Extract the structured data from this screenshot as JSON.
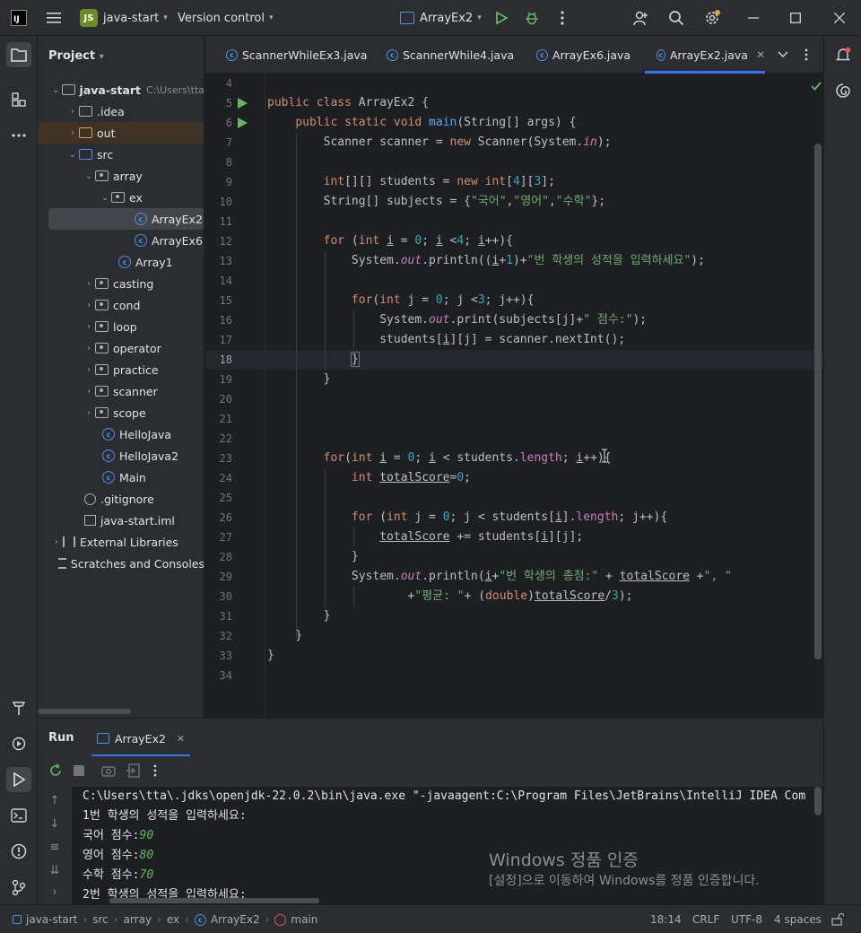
{
  "titlebar": {
    "project_badge": "JS",
    "project_name": "java-start",
    "vcs_label": "Version control",
    "run_config": "ArrayEx2"
  },
  "project_panel": {
    "title": "Project",
    "root_name": "java-start",
    "root_path": "C:\\Users\\tta",
    "items": [
      {
        "label": "java-start"
      },
      {
        "label": ".idea"
      },
      {
        "label": "out"
      },
      {
        "label": "src"
      },
      {
        "label": "array"
      },
      {
        "label": "ex"
      },
      {
        "label": "ArrayEx2"
      },
      {
        "label": "ArrayEx6"
      },
      {
        "label": "Array1"
      },
      {
        "label": "casting"
      },
      {
        "label": "cond"
      },
      {
        "label": "loop"
      },
      {
        "label": "operator"
      },
      {
        "label": "practice"
      },
      {
        "label": "scanner"
      },
      {
        "label": "scope"
      },
      {
        "label": "HelloJava"
      },
      {
        "label": "HelloJava2"
      },
      {
        "label": "Main"
      },
      {
        "label": ".gitignore"
      },
      {
        "label": "java-start.iml"
      },
      {
        "label": "External Libraries"
      },
      {
        "label": "Scratches and Consoles"
      }
    ]
  },
  "tabs": [
    {
      "label": "ScannerWhileEx3.java"
    },
    {
      "label": "ScannerWhile4.java"
    },
    {
      "label": "ArrayEx6.java"
    },
    {
      "label": "ArrayEx2.java"
    }
  ],
  "editor": {
    "line_numbers": [
      "4",
      "5",
      "6",
      "7",
      "8",
      "9",
      "10",
      "11",
      "12",
      "13",
      "14",
      "15",
      "16",
      "17",
      "18",
      "19",
      "20",
      "21",
      "22",
      "23",
      "24",
      "25",
      "26",
      "27",
      "28",
      "29",
      "30",
      "31",
      "32",
      "33",
      "34"
    ],
    "current_line": "18"
  },
  "run_panel": {
    "title": "Run",
    "tab_label": "ArrayEx2",
    "console": [
      "C:\\Users\\tta\\.jdks\\openjdk-22.0.2\\bin\\java.exe \"-javaagent:C:\\Program Files\\JetBrains\\IntelliJ IDEA Com",
      "1번 학생의 성적을 입력하세요:",
      "국어 점수:",
      "영어 점수:",
      "수학 점수:",
      "2번 학생의 성적을 입력하세요:"
    ],
    "inputs": [
      "90",
      "80",
      "70"
    ]
  },
  "watermark": {
    "title": "Windows 정품 인증",
    "subtitle": "[설정]으로 이동하여 Windows를 정품 인증합니다."
  },
  "statusbar": {
    "crumbs": [
      "java-start",
      "src",
      "array",
      "ex",
      "ArrayEx2",
      "main"
    ],
    "position": "18:14",
    "line_sep": "CRLF",
    "encoding": "UTF-8",
    "indent": "4 spaces"
  }
}
